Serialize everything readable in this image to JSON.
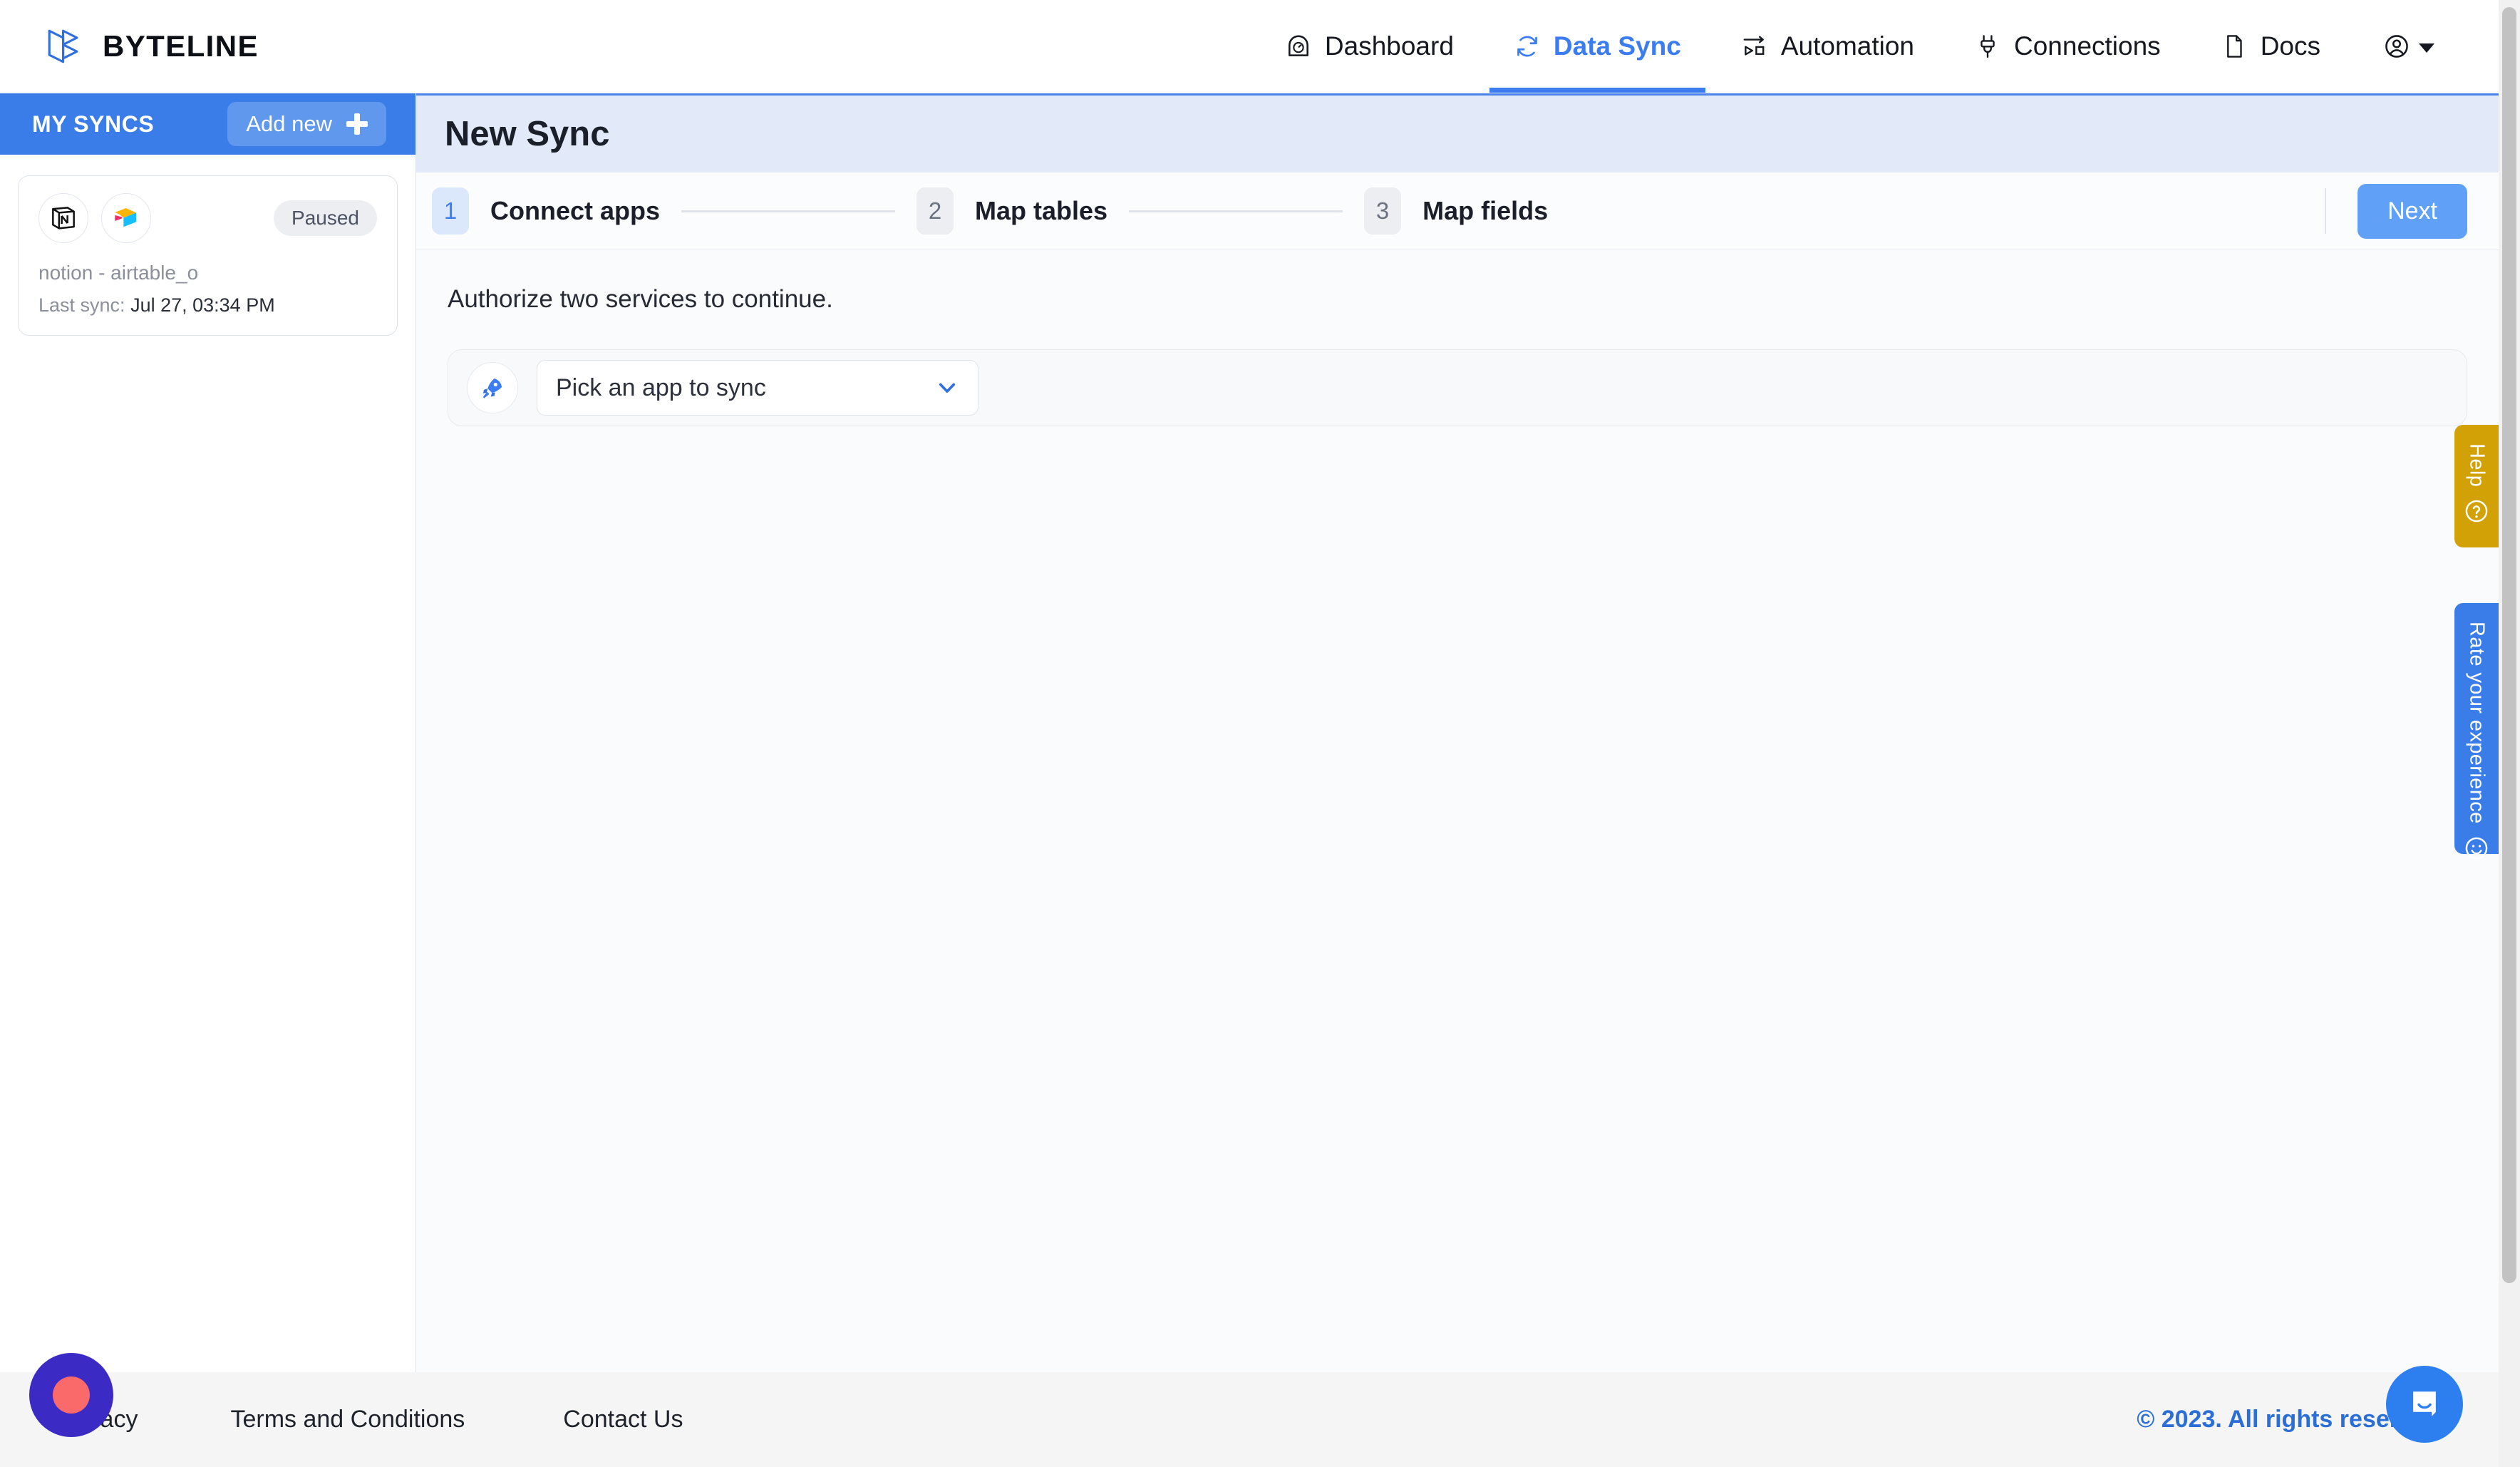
{
  "brand": {
    "name": "BYTELINE"
  },
  "nav": {
    "items": [
      {
        "label": "Dashboard",
        "icon": "gauge-icon",
        "active": false
      },
      {
        "label": "Data Sync",
        "icon": "sync-arrows-icon",
        "active": true
      },
      {
        "label": "Automation",
        "icon": "flow-icon",
        "active": false
      },
      {
        "label": "Connections",
        "icon": "plug-icon",
        "active": false
      },
      {
        "label": "Docs",
        "icon": "document-icon",
        "active": false
      }
    ],
    "account": {
      "icon": "user-circle-icon"
    },
    "active_color": "#3b7df0"
  },
  "sidebar": {
    "title": "MY SYNCS",
    "add_button": {
      "label": "Add new",
      "icon": "plus-icon"
    },
    "header_color": "#3b7de8",
    "syncs": [
      {
        "source_icon": "notion-icon",
        "target_icon": "airtable-icon",
        "status": "Paused",
        "name": "notion - airtable_o",
        "last_sync_label": "Last sync:",
        "last_sync_value": "Jul 27, 03:34 PM"
      }
    ]
  },
  "main": {
    "page_title": "New Sync",
    "stepper": {
      "steps": [
        {
          "number": "1",
          "label": "Connect apps",
          "current": true
        },
        {
          "number": "2",
          "label": "Map tables",
          "current": false
        },
        {
          "number": "3",
          "label": "Map fields",
          "current": false
        }
      ],
      "next_label": "Next"
    },
    "instruction": "Authorize two services to continue.",
    "picker": {
      "icon": "rocket-icon",
      "select_value": "Pick an app to sync",
      "chevron": "chevron-down-icon"
    }
  },
  "side_tabs": [
    {
      "label": "Help",
      "icon": "question-circle-icon",
      "color": "#d2a106"
    },
    {
      "label": "Rate your experience",
      "icon": "smiley-icon",
      "color": "#3b7de8"
    }
  ],
  "footer": {
    "links": [
      {
        "label": "Privacy"
      },
      {
        "label": "Terms and Conditions"
      },
      {
        "label": "Contact Us"
      }
    ],
    "copyright": "© 2023. All rights reserved.",
    "copyright_color": "#2b6fd6"
  },
  "widgets": {
    "record_button": {
      "icon": "record-icon",
      "color": "#3b2bc4",
      "dot_color": "#fa6a6a"
    },
    "chat_launcher": {
      "icon": "chat-bubble-icon",
      "color": "#2d7ff0"
    }
  }
}
